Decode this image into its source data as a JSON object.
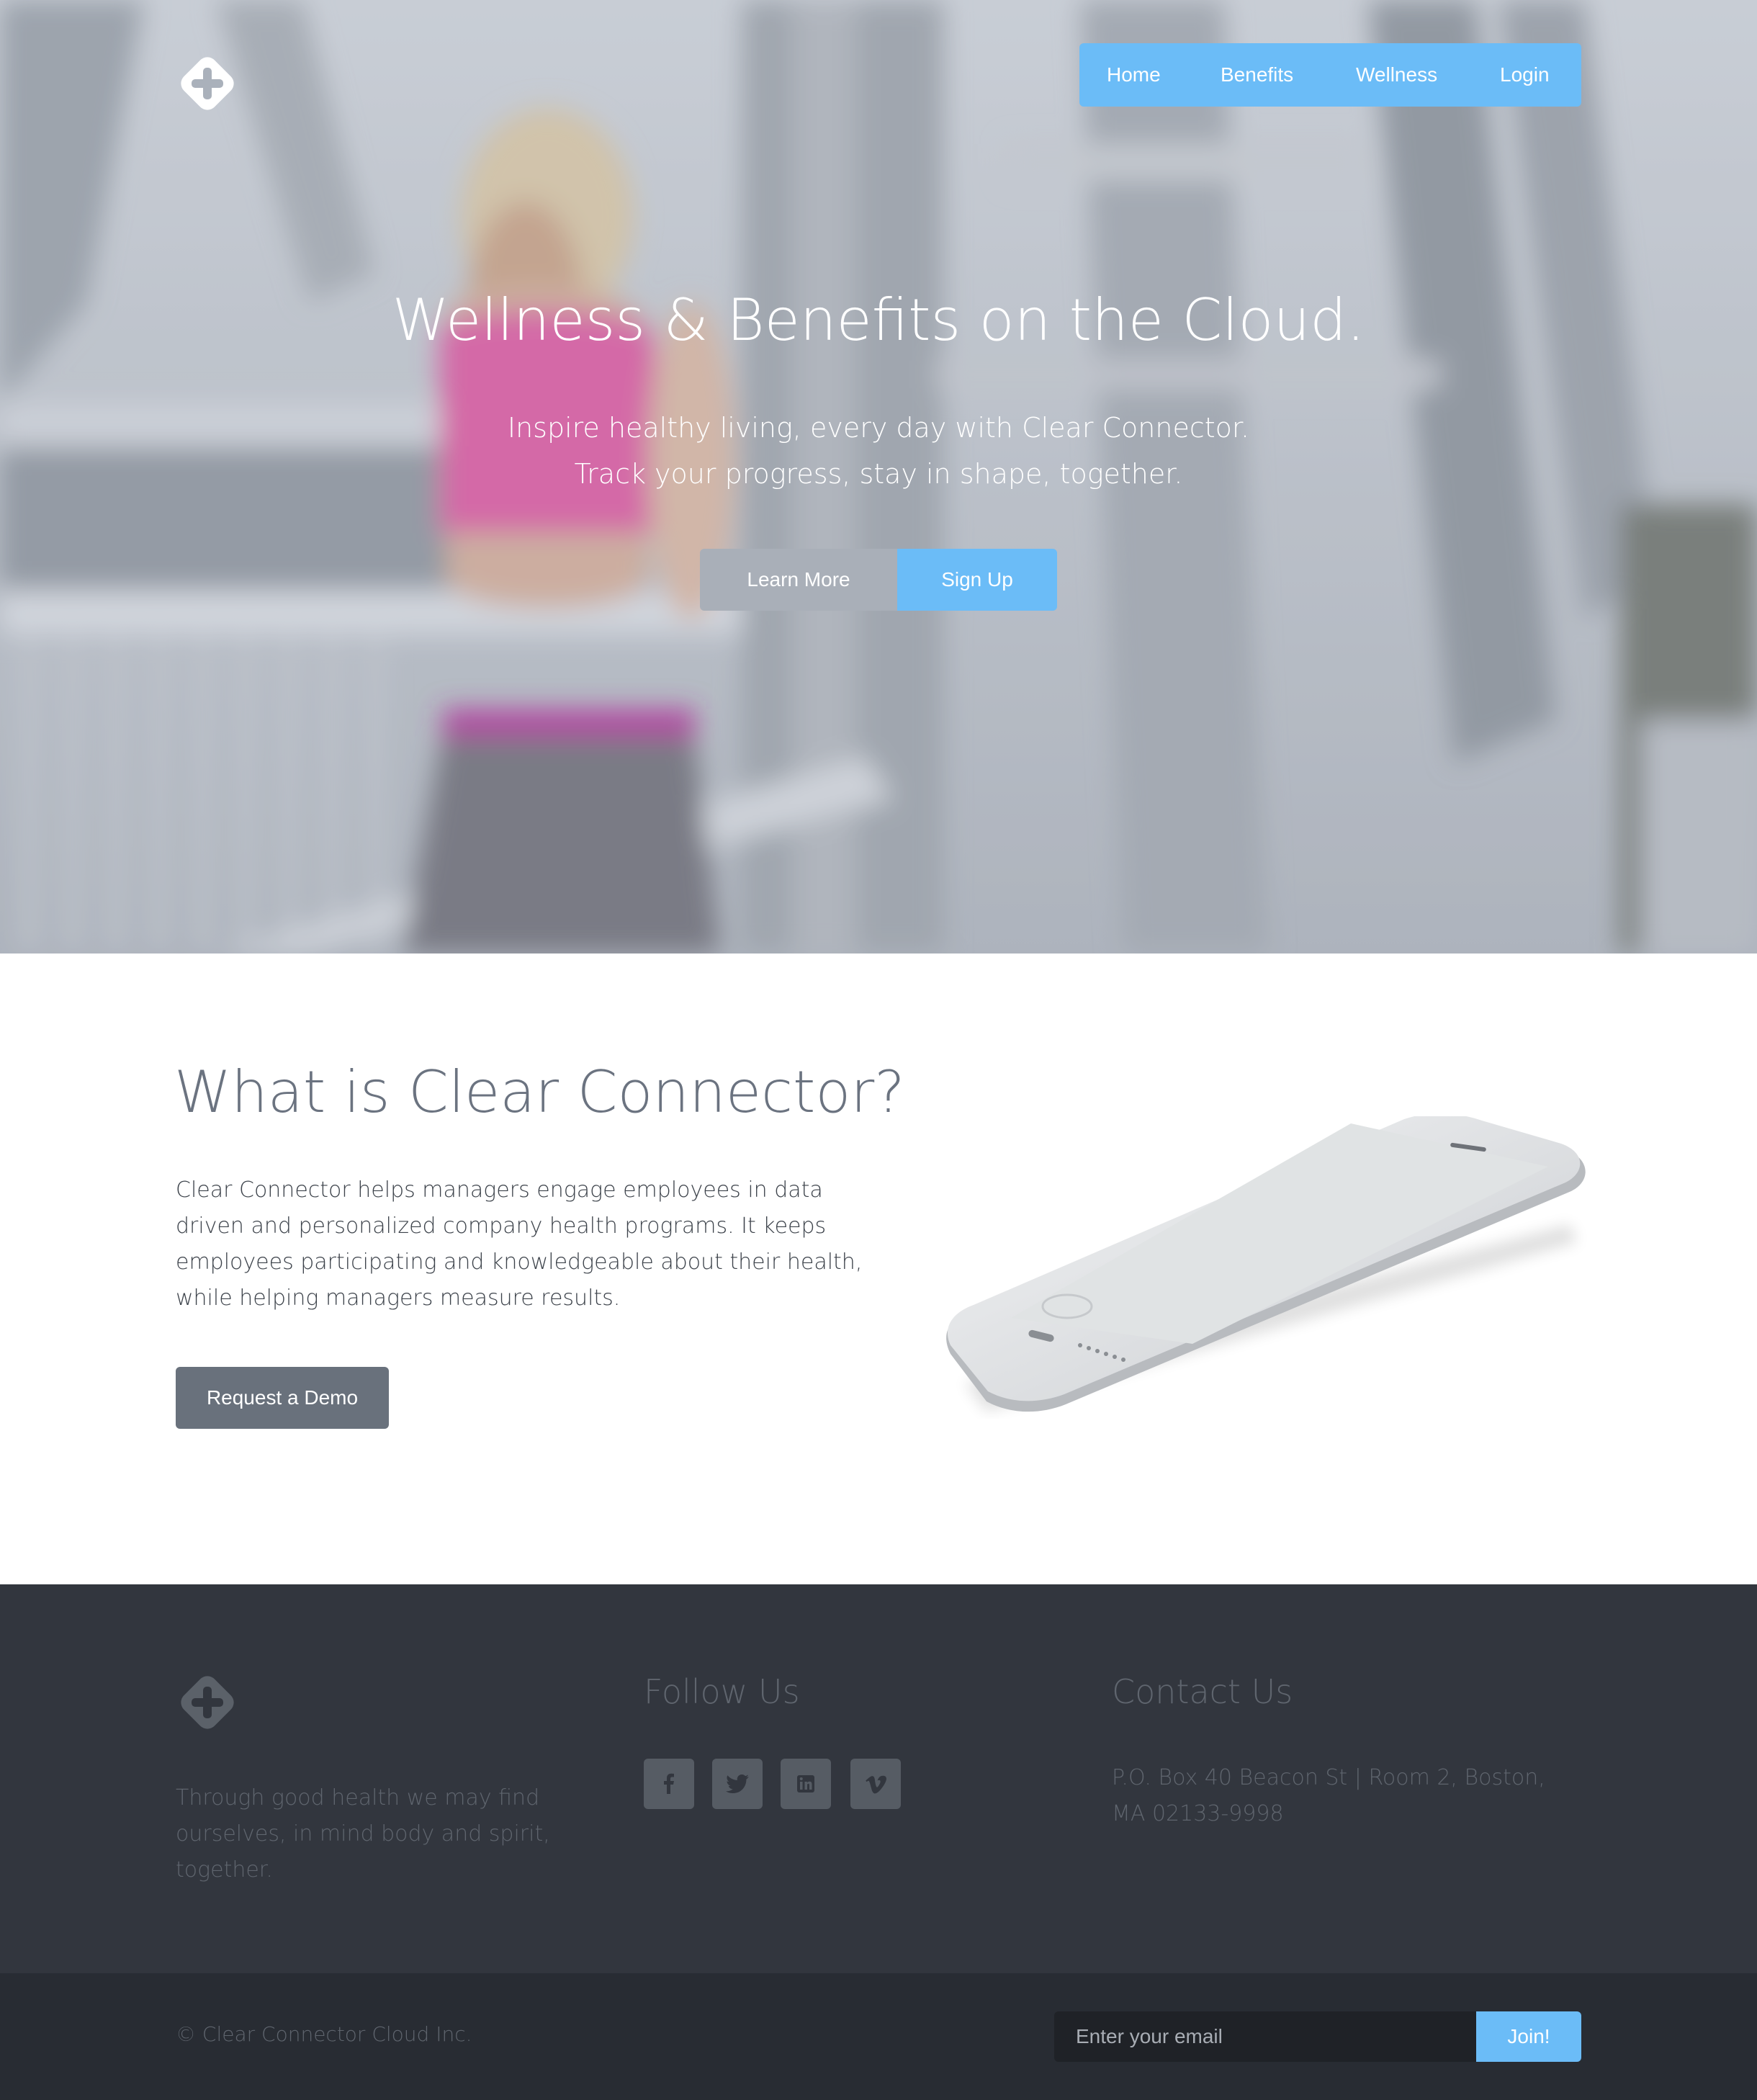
{
  "nav": {
    "items": [
      {
        "label": "Home"
      },
      {
        "label": "Benefits"
      },
      {
        "label": "Wellness"
      },
      {
        "label": "Login"
      }
    ]
  },
  "hero": {
    "title": "Wellness & Benefits on the Cloud.",
    "subtitle_line1": "Inspire healthy living, every day with Clear Connector.",
    "subtitle_line2": "Track your progress, stay in shape, together.",
    "learn_more_label": "Learn More",
    "sign_up_label": "Sign Up"
  },
  "about": {
    "title": "What is Clear Connector?",
    "text": "Clear Connector helps managers engage employees in data driven and personalized company health programs. It keeps employees participating and knowledgeable about their health, while helping managers measure results.",
    "demo_label": "Request a Demo"
  },
  "footer": {
    "tagline": "Through good health we may find ourselves, in mind body and spirit, together.",
    "follow_heading": "Follow Us",
    "social": [
      "facebook-icon",
      "twitter-icon",
      "linkedin-icon",
      "vimeo-icon"
    ],
    "contact_heading": "Contact Us",
    "address": "P.O. Box 40 Beacon St | Room 2, Boston, MA 02133-9998",
    "copyright": "© Clear Connector Cloud Inc.",
    "email_placeholder": "Enter your email",
    "join_label": "Join!"
  },
  "colors": {
    "accent": "#6bbcf7",
    "footer_bg": "#32363e",
    "bottom_bar_bg": "#282c33",
    "demo_button": "#69717c"
  }
}
